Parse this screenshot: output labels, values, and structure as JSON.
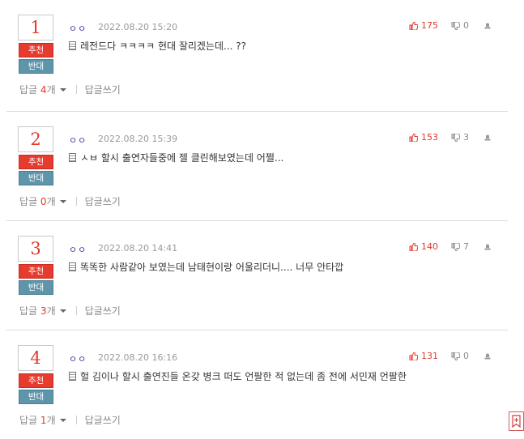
{
  "comments": [
    {
      "rank": "1",
      "up_label": "추천",
      "down_label": "반대",
      "author": "ㅇㅇ",
      "date": "2022.08.20 15:20",
      "likes": "175",
      "dislikes": "0",
      "text": "레전드다 ㅋㅋㅋㅋ 현대 잘리겠는데... ??",
      "reply_label": "답글",
      "reply_num": "4",
      "reply_suffix": "개",
      "write_label": "답글쓰기"
    },
    {
      "rank": "2",
      "up_label": "추천",
      "down_label": "반대",
      "author": "ㅇㅇ",
      "date": "2022.08.20 15:39",
      "likes": "153",
      "dislikes": "3",
      "text": "ㅅㅂ 할시 출연자들중에 젤 클린해보였는데 어쩔...",
      "reply_label": "답글",
      "reply_num": "0",
      "reply_suffix": "개",
      "write_label": "답글쓰기"
    },
    {
      "rank": "3",
      "up_label": "추천",
      "down_label": "반대",
      "author": "ㅇㅇ",
      "date": "2022.08.20 14:41",
      "likes": "140",
      "dislikes": "7",
      "text": "똑똑한 사람같아 보였는데 남태현이랑 어울리더니.... 너무 안타깝",
      "reply_label": "답글",
      "reply_num": "3",
      "reply_suffix": "개",
      "write_label": "답글쓰기"
    },
    {
      "rank": "4",
      "up_label": "추천",
      "down_label": "반대",
      "author": "ㅇㅇ",
      "date": "2022.08.20 16:16",
      "likes": "131",
      "dislikes": "0",
      "text": "헐 김이나 할시 출연진들 온갖 병크 떠도 언팔한 적 없는데 좀 전에 서민재 언팔한",
      "reply_label": "답글",
      "reply_num": "1",
      "reply_suffix": "개",
      "write_label": "답글쓰기"
    }
  ],
  "colors": {
    "accent_red": "#e03a2b",
    "down_blue": "#5f95aa"
  }
}
